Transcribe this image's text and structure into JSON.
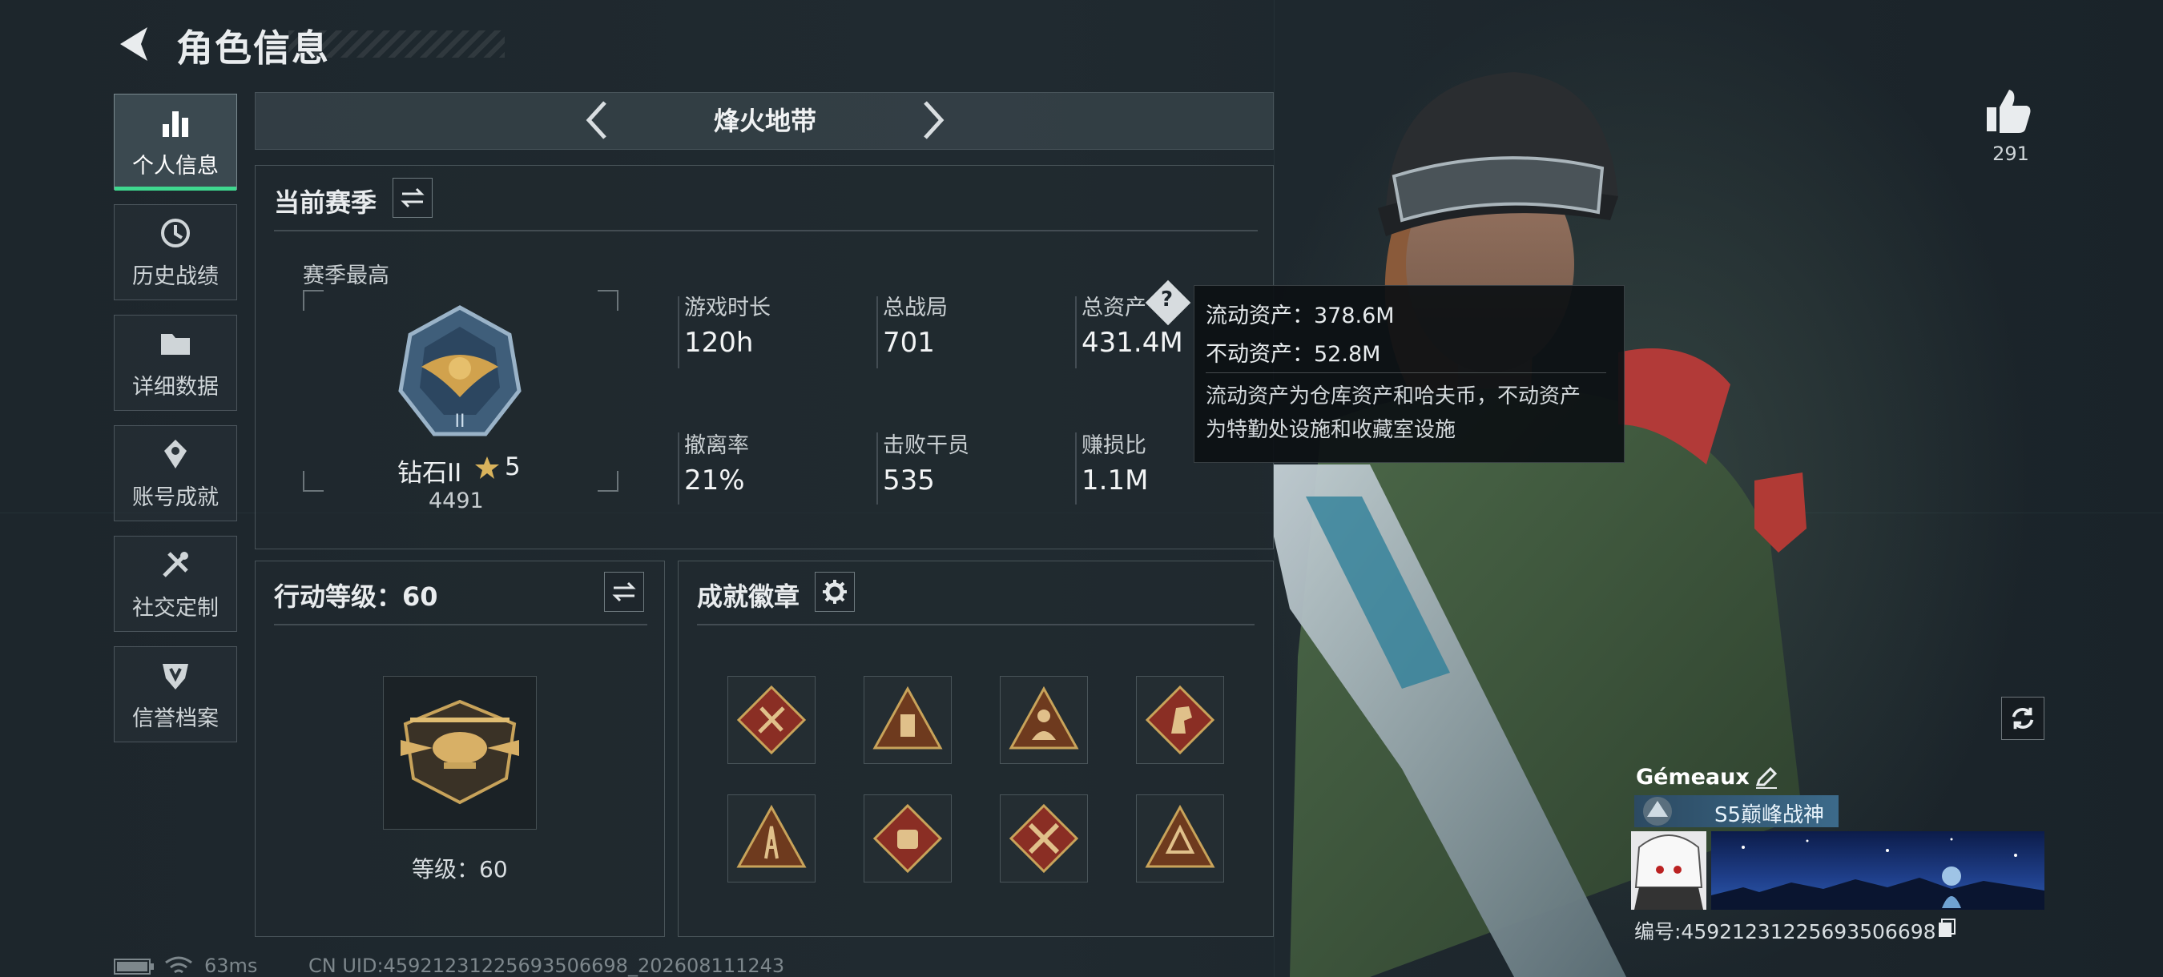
{
  "header": {
    "title": "角色信息"
  },
  "sidebar": {
    "items": [
      {
        "label": "个人信息",
        "icon": "bar-chart-icon",
        "active": true
      },
      {
        "label": "历史战绩",
        "icon": "history-clock-icon",
        "active": false
      },
      {
        "label": "详细数据",
        "icon": "folder-icon",
        "active": false
      },
      {
        "label": "账号成就",
        "icon": "achievement-icon",
        "active": false
      },
      {
        "label": "社交定制",
        "icon": "tools-icon",
        "active": false
      },
      {
        "label": "信誉档案",
        "icon": "credit-shield-icon",
        "active": false
      }
    ]
  },
  "mode": {
    "title": "烽火地带"
  },
  "season": {
    "title": "当前赛季",
    "best_label": "赛季最高",
    "rank_name": "钻石II",
    "rank_stars": "5",
    "rank_score": "4491",
    "stats": [
      {
        "label": "游戏时长",
        "value": "120h"
      },
      {
        "label": "总战局",
        "value": "701"
      },
      {
        "label": "总资产",
        "value": "431.4M"
      },
      {
        "label": "撤离率",
        "value": "21%"
      },
      {
        "label": "击败干员",
        "value": "535"
      },
      {
        "label": "赚损比",
        "value": "1.1M"
      }
    ]
  },
  "tooltip": {
    "liquid": "流动资产：378.6M",
    "fixed": "不动资产：52.8M",
    "desc_line1": "流动资产为仓库资产和哈夫币，不动资产",
    "desc_line2": "为特勤处设施和收藏室设施"
  },
  "action_level": {
    "title": "行动等级：60",
    "level_text": "等级：60"
  },
  "achievements": {
    "title": "成就徽章",
    "badges": [
      {
        "icon": "badge-diamond-tools-icon"
      },
      {
        "icon": "badge-triangle-cup-icon"
      },
      {
        "icon": "badge-triangle-figure-icon"
      },
      {
        "icon": "badge-diamond-horse-icon"
      },
      {
        "icon": "badge-triangle-ladder-icon"
      },
      {
        "icon": "badge-diamond-fist-icon"
      },
      {
        "icon": "badge-diamond-cross-icon"
      },
      {
        "icon": "badge-triangle-emblem-icon"
      }
    ]
  },
  "profile": {
    "likes": "291",
    "name": "Gémeaux",
    "rank_tag": "S5巅峰战神",
    "uid": "编号:4592123122569350669​8"
  },
  "footer": {
    "ping": "63ms",
    "uid": "CN UID:45921231225693506698_202608111243"
  },
  "colors": {
    "accent": "#3fd88f",
    "badge_red": "#8a2e24",
    "badge_gold": "#c8a35a",
    "tooltip_bg": "#0c1013"
  }
}
